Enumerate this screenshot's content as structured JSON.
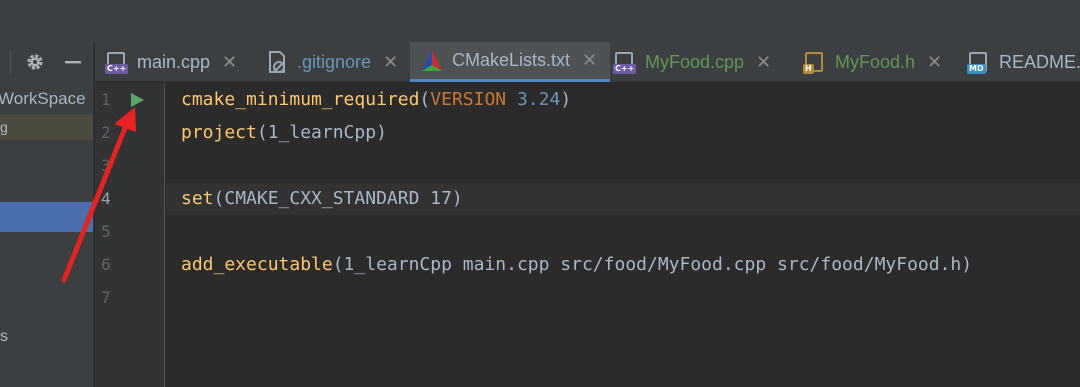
{
  "sidebar": {
    "workspace_label": "WorkSpace",
    "highlight_label": "g",
    "bottom_label": "s"
  },
  "tabs": [
    {
      "label": "main.cpp",
      "badge": "C++",
      "color": "#a9b7c6"
    },
    {
      "label": ".gitignore",
      "badge": "",
      "color": "#6897bb"
    },
    {
      "label": "CMakeLists.txt",
      "badge": "",
      "color": "#a9b7c6",
      "active": true
    },
    {
      "label": "MyFood.cpp",
      "badge": "C++",
      "color": "#629755"
    },
    {
      "label": "MyFood.h",
      "badge": "H",
      "color": "#629755"
    },
    {
      "label": "README.",
      "badge": "MD",
      "color": "#a9b7c6"
    }
  ],
  "gutter": {
    "line_numbers": [
      "1",
      "2",
      "3",
      "4",
      "5",
      "6",
      "7"
    ]
  },
  "code": {
    "line1": {
      "func": "cmake_minimum_required",
      "open": "(",
      "kw": "VERSION",
      "space": " ",
      "num": "3.24",
      "close": ")"
    },
    "line2": {
      "func": "project",
      "rest": "(1_learnCpp)"
    },
    "line4": {
      "func": "set",
      "rest": "(CMAKE_CXX_STANDARD 17)"
    },
    "line6": {
      "func": "add_executable",
      "rest": "(1_learnCpp main.cpp src/food/MyFood.cpp src/food/MyFood.h)"
    }
  },
  "colors": {
    "function": "#ffc66d",
    "keyword": "#cc7832",
    "number": "#6897bb",
    "annotation_arrow": "#e8231f",
    "run_icon": "#59a869"
  },
  "icons": [
    "gear-icon",
    "minus-icon",
    "close-icon",
    "run-icon",
    "cmake-icon",
    "cpp-file-icon",
    "header-file-icon",
    "markdown-file-icon",
    "gitignore-file-icon"
  ]
}
